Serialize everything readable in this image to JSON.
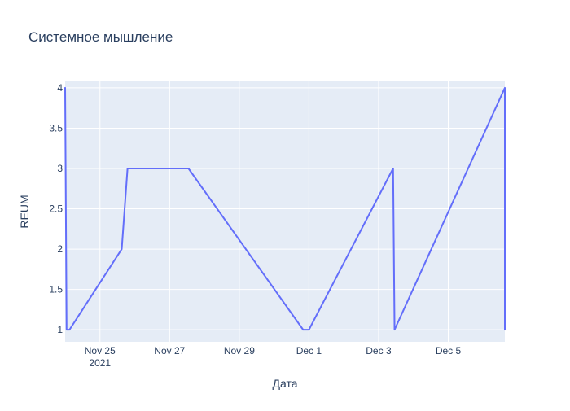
{
  "chart_data": {
    "type": "line",
    "title": "Системное мышление",
    "xlabel": "Дата",
    "ylabel": "REUM",
    "x_type": "date",
    "xlim": [
      "2021-11-24T00:00",
      "2021-12-06T15:00"
    ],
    "ylim": [
      0.85,
      4.08
    ],
    "grid": true,
    "plot_bg": "#e5ecf6",
    "line_color": "#636efa",
    "x_ticks": [
      {
        "value": "2021-11-25T00:00",
        "label": "Nov 25",
        "sublabel": "2021"
      },
      {
        "value": "2021-11-27T00:00",
        "label": "Nov 27",
        "sublabel": ""
      },
      {
        "value": "2021-11-29T00:00",
        "label": "Nov 29",
        "sublabel": ""
      },
      {
        "value": "2021-12-01T00:00",
        "label": "Dec 1",
        "sublabel": ""
      },
      {
        "value": "2021-12-03T00:00",
        "label": "Dec 3",
        "sublabel": ""
      },
      {
        "value": "2021-12-05T00:00",
        "label": "Dec 5",
        "sublabel": ""
      }
    ],
    "y_ticks": [
      {
        "value": 1,
        "label": "1"
      },
      {
        "value": 1.5,
        "label": "1.5"
      },
      {
        "value": 2,
        "label": "2"
      },
      {
        "value": 2.5,
        "label": "2.5"
      },
      {
        "value": 3,
        "label": "3"
      },
      {
        "value": 3.5,
        "label": "3.5"
      },
      {
        "value": 4,
        "label": "4"
      }
    ],
    "series": [
      {
        "points": [
          {
            "x": "2021-11-24T00:00",
            "y": 4
          },
          {
            "x": "2021-11-24T01:00",
            "y": 1
          },
          {
            "x": "2021-11-24T03:00",
            "y": 1
          },
          {
            "x": "2021-11-25T15:00",
            "y": 2
          },
          {
            "x": "2021-11-25T19:00",
            "y": 3
          },
          {
            "x": "2021-11-27T13:00",
            "y": 3
          },
          {
            "x": "2021-11-30T20:00",
            "y": 1
          },
          {
            "x": "2021-12-01T00:00",
            "y": 1
          },
          {
            "x": "2021-12-03T10:00",
            "y": 3
          },
          {
            "x": "2021-12-03T11:00",
            "y": 1
          },
          {
            "x": "2021-12-06T15:00",
            "y": 4
          },
          {
            "x": "2021-12-06T15:00",
            "y": 1
          }
        ]
      }
    ]
  }
}
